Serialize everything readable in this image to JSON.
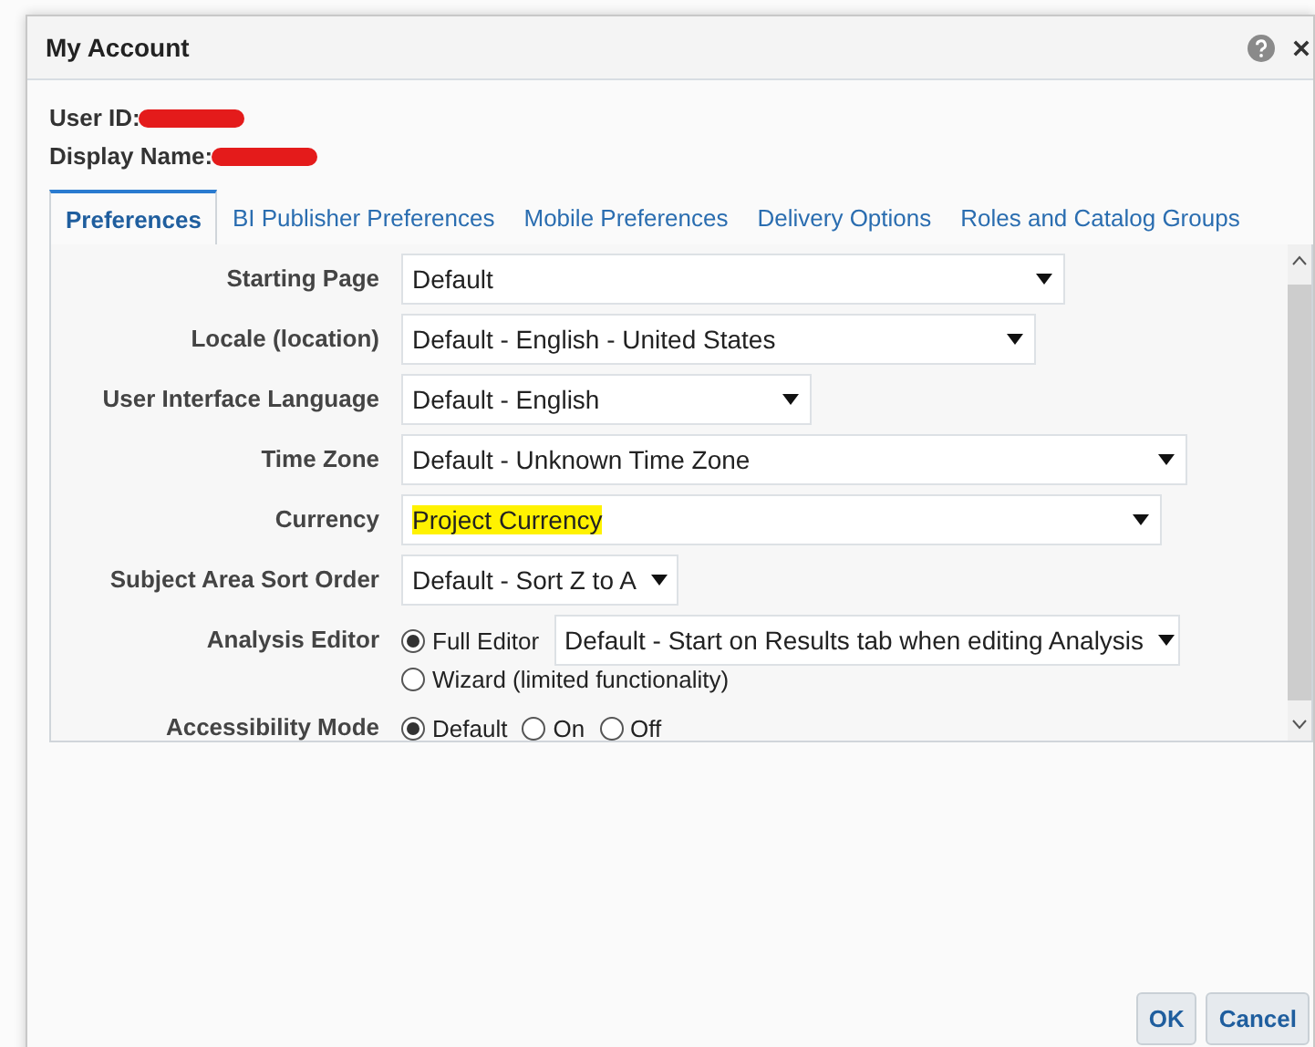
{
  "window": {
    "title": "My Account"
  },
  "identity": [
    {
      "label": "User ID:"
    },
    {
      "label": "Display Name:"
    }
  ],
  "tabs": [
    {
      "label": "Preferences",
      "selected": true
    },
    {
      "label": "BI Publisher Preferences",
      "selected": false
    },
    {
      "label": "Mobile Preferences",
      "selected": false
    },
    {
      "label": "Delivery Options",
      "selected": false
    },
    {
      "label": "Roles and Catalog Groups",
      "selected": false
    }
  ],
  "fields": [
    {
      "kind": "select",
      "label": "Starting Page",
      "value": "Default",
      "highlighted": false
    },
    {
      "kind": "select",
      "label": "Locale (location)",
      "value": "Default - English - United States",
      "highlighted": false
    },
    {
      "kind": "select",
      "label": "User Interface Language",
      "value": "Default - English",
      "highlighted": false
    },
    {
      "kind": "select",
      "label": "Time Zone",
      "value": "Default - Unknown Time Zone",
      "highlighted": false
    },
    {
      "kind": "select",
      "label": "Currency",
      "value": "Project Currency",
      "highlighted": true
    },
    {
      "kind": "select",
      "label": "Subject Area Sort Order",
      "value": "Default - Sort Z to A",
      "highlighted": false
    },
    {
      "kind": "editor",
      "label": "Analysis Editor",
      "options": [
        {
          "label": "Full Editor",
          "selected": true,
          "value": "Default - Start on Results tab when editing Analysis"
        },
        {
          "label": "Wizard (limited functionality)",
          "selected": false
        }
      ]
    },
    {
      "kind": "radios",
      "label": "Accessibility Mode",
      "options": [
        {
          "label": "Default",
          "selected": true
        },
        {
          "label": "On",
          "selected": false
        },
        {
          "label": "Off",
          "selected": false
        }
      ]
    }
  ],
  "buttons": [
    {
      "label": "OK"
    },
    {
      "label": "Cancel"
    }
  ]
}
